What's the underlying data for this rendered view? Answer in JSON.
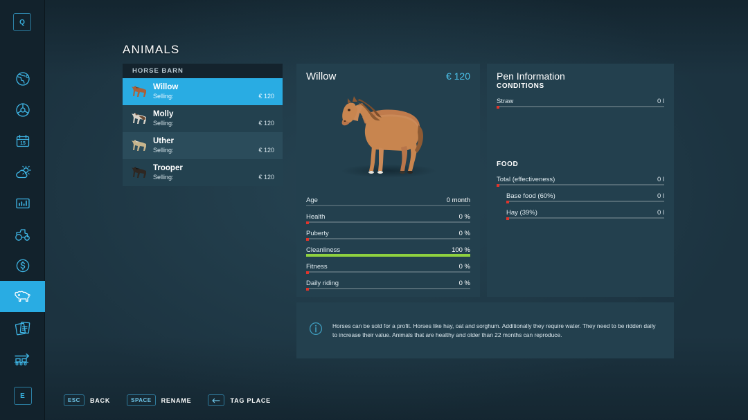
{
  "page": {
    "title": "ANIMALS"
  },
  "sidebar": {
    "top_key": "Q",
    "bottom_key": "E",
    "items": [
      {
        "icon": "globe-icon",
        "name": "map",
        "active": false
      },
      {
        "icon": "steering-wheel-icon",
        "name": "vehicles",
        "active": false
      },
      {
        "icon": "calendar-icon",
        "name": "calendar",
        "active": false,
        "day": "15"
      },
      {
        "icon": "weather-icon",
        "name": "weather",
        "active": false
      },
      {
        "icon": "statistics-icon",
        "name": "statistics",
        "active": false
      },
      {
        "icon": "tractor-icon",
        "name": "machines",
        "active": false
      },
      {
        "icon": "dollar-icon",
        "name": "finances",
        "active": false
      },
      {
        "icon": "cow-icon",
        "name": "animals",
        "active": true
      },
      {
        "icon": "documents-icon",
        "name": "contracts",
        "active": false
      },
      {
        "icon": "production-icon",
        "name": "production",
        "active": false
      }
    ]
  },
  "list": {
    "header": "HORSE BARN",
    "selling_label": "Selling:",
    "rows": [
      {
        "name": "Willow",
        "status": "Selling:",
        "price": "€ 120",
        "selected": true,
        "coat": "#a9613b",
        "mane": "#6b3c22"
      },
      {
        "name": "Molly",
        "status": "Selling:",
        "price": "€ 120",
        "selected": false,
        "coat": "#d8d2c8",
        "mane": "#6b4a33"
      },
      {
        "name": "Uther",
        "status": "Selling:",
        "price": "€ 120",
        "selected": false,
        "coat": "#c6b48c",
        "mane": "#e3ddd0"
      },
      {
        "name": "Trooper",
        "status": "Selling:",
        "price": "€ 120",
        "selected": false,
        "coat": "#2e2722",
        "mane": "#15110e"
      }
    ]
  },
  "detail": {
    "name": "Willow",
    "price": "€ 120",
    "stats": [
      {
        "label": "Age",
        "value": "0 month",
        "percent": 0,
        "bar": false
      },
      {
        "label": "Health",
        "value": "0 %",
        "percent": 0,
        "bar": true
      },
      {
        "label": "Puberty",
        "value": "0 %",
        "percent": 0,
        "bar": true
      },
      {
        "label": "Cleanliness",
        "value": "100 %",
        "percent": 100,
        "bar": true
      },
      {
        "label": "Fitness",
        "value": "0 %",
        "percent": 0,
        "bar": true
      },
      {
        "label": "Daily riding",
        "value": "0 %",
        "percent": 0,
        "bar": true
      }
    ]
  },
  "pen": {
    "title": "Pen Information",
    "conditions_label": "CONDITIONS",
    "conditions": [
      {
        "label": "Straw",
        "value": "0 l",
        "percent": 0,
        "indent": false
      }
    ],
    "food_label": "FOOD",
    "food": [
      {
        "label": "Total (effectiveness)",
        "value": "0 l",
        "percent": 0,
        "indent": false
      },
      {
        "label": "Base food (60%)",
        "value": "0 l",
        "percent": 0,
        "indent": true
      },
      {
        "label": "Hay (39%)",
        "value": "0 l",
        "percent": 0,
        "indent": true
      }
    ]
  },
  "info": {
    "icon": "info-circle-icon",
    "text": "Horses can be sold for a profit. Horses like hay, oat and sorghum. Additionally they require water. They need to be ridden daily to increase their value. Animals that are healthy and older than 22 months can reproduce."
  },
  "hotkeys": [
    {
      "key": "ESC",
      "label": "BACK",
      "glyph": false
    },
    {
      "key": "SPACE",
      "label": "RENAME",
      "glyph": false
    },
    {
      "key": "←",
      "label": "TAG PLACE",
      "glyph": true
    }
  ],
  "colors": {
    "accent": "#29ace3",
    "price": "#4cc3ec",
    "bar_good": "#8fd13f",
    "bar_zero": "#e0342b",
    "panel": "#23404e",
    "background": "#1c3340"
  }
}
